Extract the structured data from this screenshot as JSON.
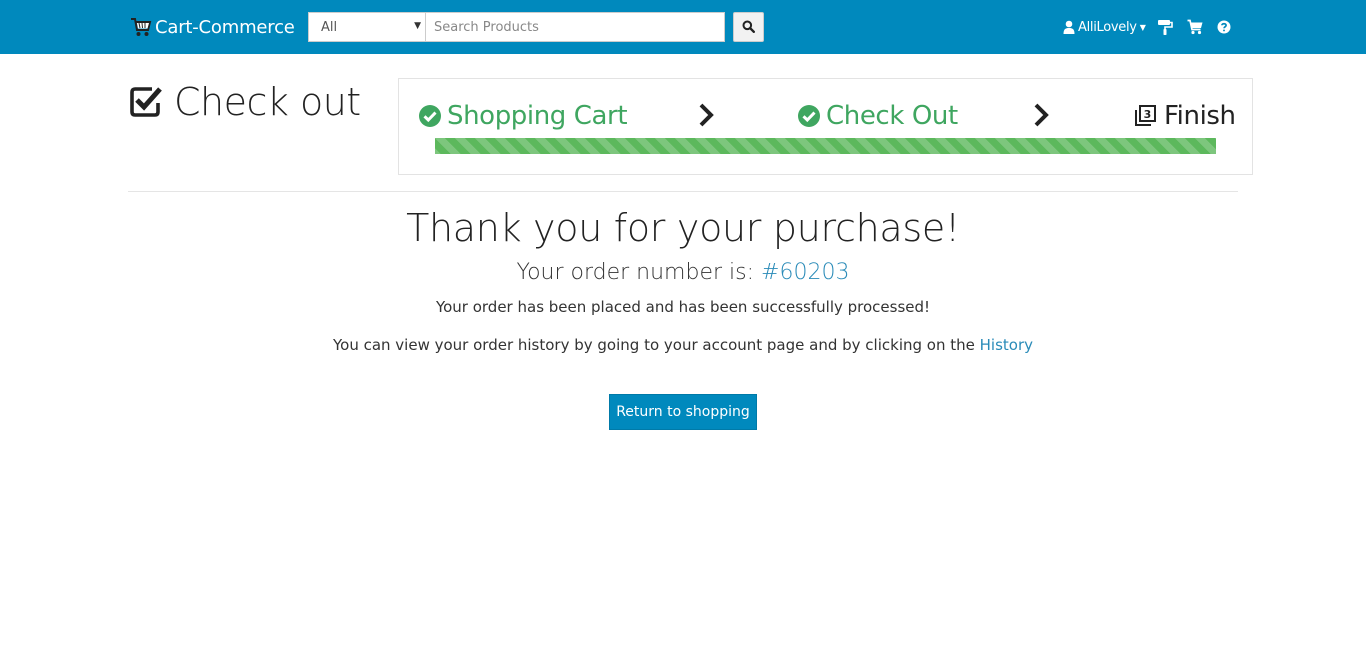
{
  "navbar": {
    "brand": "Cart-Commerce",
    "brand_icon": "cart-icon",
    "category_select": {
      "selected": "All"
    },
    "search": {
      "placeholder": "Search Products",
      "value": "",
      "button_icon": "search-icon"
    },
    "user": {
      "name": "AlliLovely",
      "icon": "user-icon"
    },
    "icons": [
      "paint-roller-icon",
      "cart-icon",
      "help-icon"
    ],
    "background_color": "#0089bd"
  },
  "header": {
    "title": "Check out",
    "title_icon": "checkbox-checked-icon",
    "steps": [
      {
        "label": "Shopping Cart",
        "status": "done",
        "icon": "check-circle-icon"
      },
      {
        "label": "Check Out",
        "status": "done",
        "icon": "check-circle-icon"
      },
      {
        "label": "Finish",
        "status": "current",
        "icon": "step-3-icon"
      }
    ],
    "step_separator_icon": "chevron-right-icon",
    "progress_fraction": 1.0,
    "done_color": "#3fa660"
  },
  "confirmation": {
    "heading": "Thank you for your purchase!",
    "order_prefix": "Your order number is:",
    "order_number": "#60203",
    "placed_message": "Your order has been placed and has been successfully processed!",
    "history_text": "You can view your order history by going to your account page and by clicking on the",
    "history_link": "History",
    "return_button": "Return to shopping",
    "link_color": "#2a8bb8"
  }
}
